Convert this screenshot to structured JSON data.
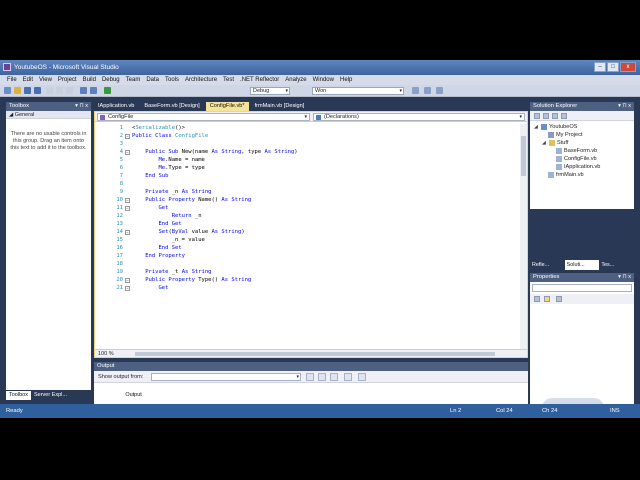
{
  "window": {
    "title": "YoutubeOS - Microsoft Visual Studio",
    "minimize": "–",
    "maximize": "□",
    "close": "x"
  },
  "menu": [
    "File",
    "Edit",
    "View",
    "Project",
    "Build",
    "Debug",
    "Team",
    "Data",
    "Tools",
    "Architecture",
    "Test",
    ".NET Reflector",
    "Analyze",
    "Window",
    "Help"
  ],
  "toolbar": {
    "config": "Debug",
    "search": "Won"
  },
  "toolbox": {
    "title": "Toolbox",
    "group": "General",
    "message": "There are no usable controls in this group. Drag an item onto this text to add it to the toolbox."
  },
  "left_tabs": [
    "Toolbox",
    "Server Expl..."
  ],
  "doc_tabs": [
    "IApplication.vb",
    "BaseForm.vb [Design]",
    "ConfigFile.vb*",
    "frmMain.vb [Design]"
  ],
  "editor": {
    "class_dropdown": "ConfigFile",
    "member_dropdown": "(Declarations)",
    "zoom": "100 %",
    "lines": [
      {
        "n": "1",
        "segs": [
          [
            "pl",
            "<"
          ],
          [
            "ty",
            "Serializable"
          ],
          [
            "pl",
            "()>"
          ]
        ]
      },
      {
        "n": "2",
        "segs": [
          [
            "kw",
            "Public Class "
          ],
          [
            "ty",
            "ConfigFile"
          ]
        ]
      },
      {
        "n": "3",
        "segs": [
          [
            "pl",
            ""
          ]
        ]
      },
      {
        "n": "4",
        "segs": [
          [
            "kw",
            "    Public Sub "
          ],
          [
            "pl",
            "New(name "
          ],
          [
            "kw",
            "As String"
          ],
          [
            "pl",
            ", type "
          ],
          [
            "kw",
            "As String"
          ],
          [
            "pl",
            ")"
          ]
        ]
      },
      {
        "n": "5",
        "segs": [
          [
            "kw",
            "        Me"
          ],
          [
            "pl",
            ".Name = name"
          ]
        ]
      },
      {
        "n": "6",
        "segs": [
          [
            "kw",
            "        Me"
          ],
          [
            "pl",
            ".Type = type"
          ]
        ]
      },
      {
        "n": "7",
        "segs": [
          [
            "kw",
            "    End Sub"
          ]
        ]
      },
      {
        "n": "8",
        "segs": [
          [
            "pl",
            ""
          ]
        ]
      },
      {
        "n": "9",
        "segs": [
          [
            "kw",
            "    Private "
          ],
          [
            "pl",
            "_n "
          ],
          [
            "kw",
            "As String"
          ]
        ]
      },
      {
        "n": "10",
        "segs": [
          [
            "kw",
            "    Public Property "
          ],
          [
            "pl",
            "Name() "
          ],
          [
            "kw",
            "As String"
          ]
        ]
      },
      {
        "n": "11",
        "segs": [
          [
            "kw",
            "        Get"
          ]
        ]
      },
      {
        "n": "12",
        "segs": [
          [
            "kw",
            "            Return "
          ],
          [
            "pl",
            "_n"
          ]
        ]
      },
      {
        "n": "13",
        "segs": [
          [
            "kw",
            "        End Get"
          ]
        ]
      },
      {
        "n": "14",
        "segs": [
          [
            "kw",
            "        Set"
          ],
          [
            "pl",
            "("
          ],
          [
            "kw",
            "ByVal "
          ],
          [
            "pl",
            "value "
          ],
          [
            "kw",
            "As String"
          ],
          [
            "pl",
            ")"
          ]
        ]
      },
      {
        "n": "15",
        "segs": [
          [
            "pl",
            "            _n = value"
          ]
        ]
      },
      {
        "n": "16",
        "segs": [
          [
            "kw",
            "        End Set"
          ]
        ]
      },
      {
        "n": "17",
        "segs": [
          [
            "kw",
            "    End Property"
          ]
        ]
      },
      {
        "n": "18",
        "segs": [
          [
            "pl",
            ""
          ]
        ]
      },
      {
        "n": "19",
        "segs": [
          [
            "kw",
            "    Private "
          ],
          [
            "pl",
            "_t "
          ],
          [
            "kw",
            "As String"
          ]
        ]
      },
      {
        "n": "20",
        "segs": [
          [
            "kw",
            "    Public Property "
          ],
          [
            "pl",
            "Type() "
          ],
          [
            "kw",
            "As String"
          ]
        ]
      },
      {
        "n": "21",
        "segs": [
          [
            "kw",
            "        Get"
          ]
        ]
      }
    ]
  },
  "output": {
    "title": "Output",
    "show_from": "Show output from:"
  },
  "mid_tabs": [
    "Error List",
    "Output"
  ],
  "solution_explorer": {
    "title": "Solution Explorer",
    "project": "YoutubeOS",
    "items": [
      "My Project",
      "Stuff",
      "BaseForm.vb",
      "ConfigFile.vb",
      "IApplication.vb",
      "frmMain.vb"
    ],
    "tabs": [
      "Refle...",
      "Soluti...",
      "Tes..."
    ]
  },
  "properties": {
    "title": "Properties"
  },
  "watermark": "MW",
  "status": {
    "state": "Ready",
    "ln": "Ln 2",
    "col": "Col 24",
    "ch": "Ch 24",
    "mode": "INS"
  }
}
